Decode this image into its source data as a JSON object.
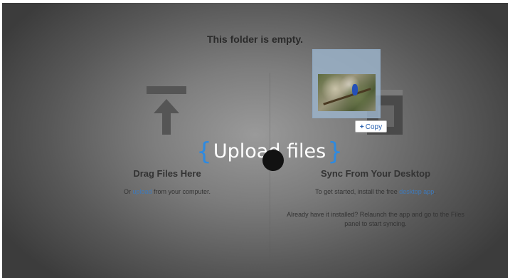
{
  "empty_state": {
    "title": "This folder is empty."
  },
  "overlay": {
    "brace_open": "{",
    "label": "Upload files",
    "brace_close": "}"
  },
  "drag": {
    "heading": "Drag Files Here",
    "text_prefix": "Or ",
    "link": "upload",
    "text_suffix": " from your computer."
  },
  "sync": {
    "heading": "Sync From Your Desktop",
    "text_prefix": "To get started, install the free ",
    "link": "desktop app",
    "text_suffix": ".",
    "text2": "Already have it installed? Relaunch the app and go to the Files panel to start syncing."
  },
  "copy_badge": {
    "icon": "plus-icon",
    "label": "Copy"
  },
  "icons": {
    "upload": "upload-arrow-icon"
  },
  "colors": {
    "brace": "#2e8ae0",
    "link": "#3f79b8"
  }
}
